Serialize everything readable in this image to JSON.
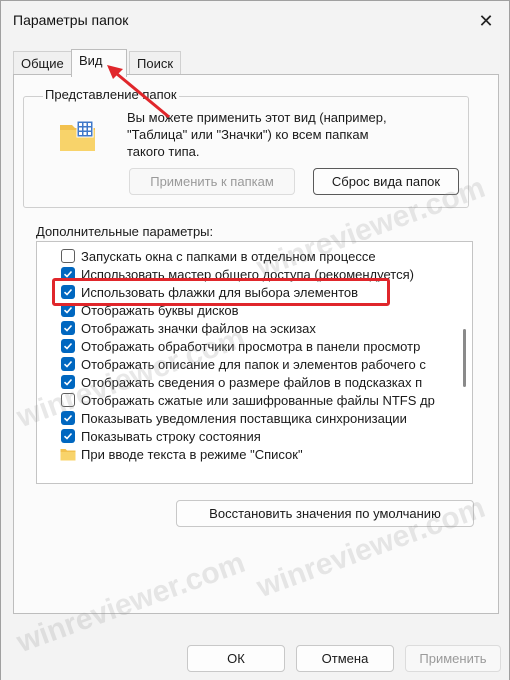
{
  "window": {
    "title": "Параметры папок",
    "close_glyph": "✕"
  },
  "tabs": [
    {
      "label": "Общие"
    },
    {
      "label": "Вид",
      "active": true
    },
    {
      "label": "Поиск"
    }
  ],
  "folder_view": {
    "legend": "Представление папок",
    "description_lines": [
      "Вы можете применить этот вид (например,",
      "\"Таблица\" или \"Значки\") ко всем папкам",
      "такого типа."
    ],
    "apply_button": "Применить к папкам",
    "reset_button": "Сброс вида папок",
    "icon": "folder-view-icon"
  },
  "advanced": {
    "label": "Дополнительные параметры:",
    "items": [
      {
        "label": "Запускать окна с папками в отдельном процессе",
        "checked": false
      },
      {
        "label": "Использовать мастер общего доступа (рекомендуется)",
        "checked": true
      },
      {
        "label": "Использовать флажки для выбора элементов",
        "checked": true,
        "highlighted": true
      },
      {
        "label": "Отображать буквы дисков",
        "checked": true
      },
      {
        "label": "Отображать значки файлов на эскизах",
        "checked": true
      },
      {
        "label": "Отображать обработчики просмотра в панели просмотр",
        "checked": true
      },
      {
        "label": "Отображать описание для папок и элементов рабочего с",
        "checked": true
      },
      {
        "label": "Отображать сведения о размере файлов в подсказках п",
        "checked": true
      },
      {
        "label": "Отображать сжатые или зашифрованные файлы NTFS др",
        "checked": false
      },
      {
        "label": "Показывать уведомления поставщика синхронизации",
        "checked": true
      },
      {
        "label": "Показывать строку состояния",
        "checked": true
      },
      {
        "label": "При вводе текста в режиме \"Список\"",
        "folder": true
      }
    ]
  },
  "restore_button": "Восстановить значения по умолчанию",
  "footer": {
    "ok": "ОК",
    "cancel": "Отмена",
    "apply": "Применить"
  },
  "annotation": {
    "highlight_color": "#e0262b",
    "accent": "#0067c0"
  },
  "watermark": "winreviewer.com"
}
